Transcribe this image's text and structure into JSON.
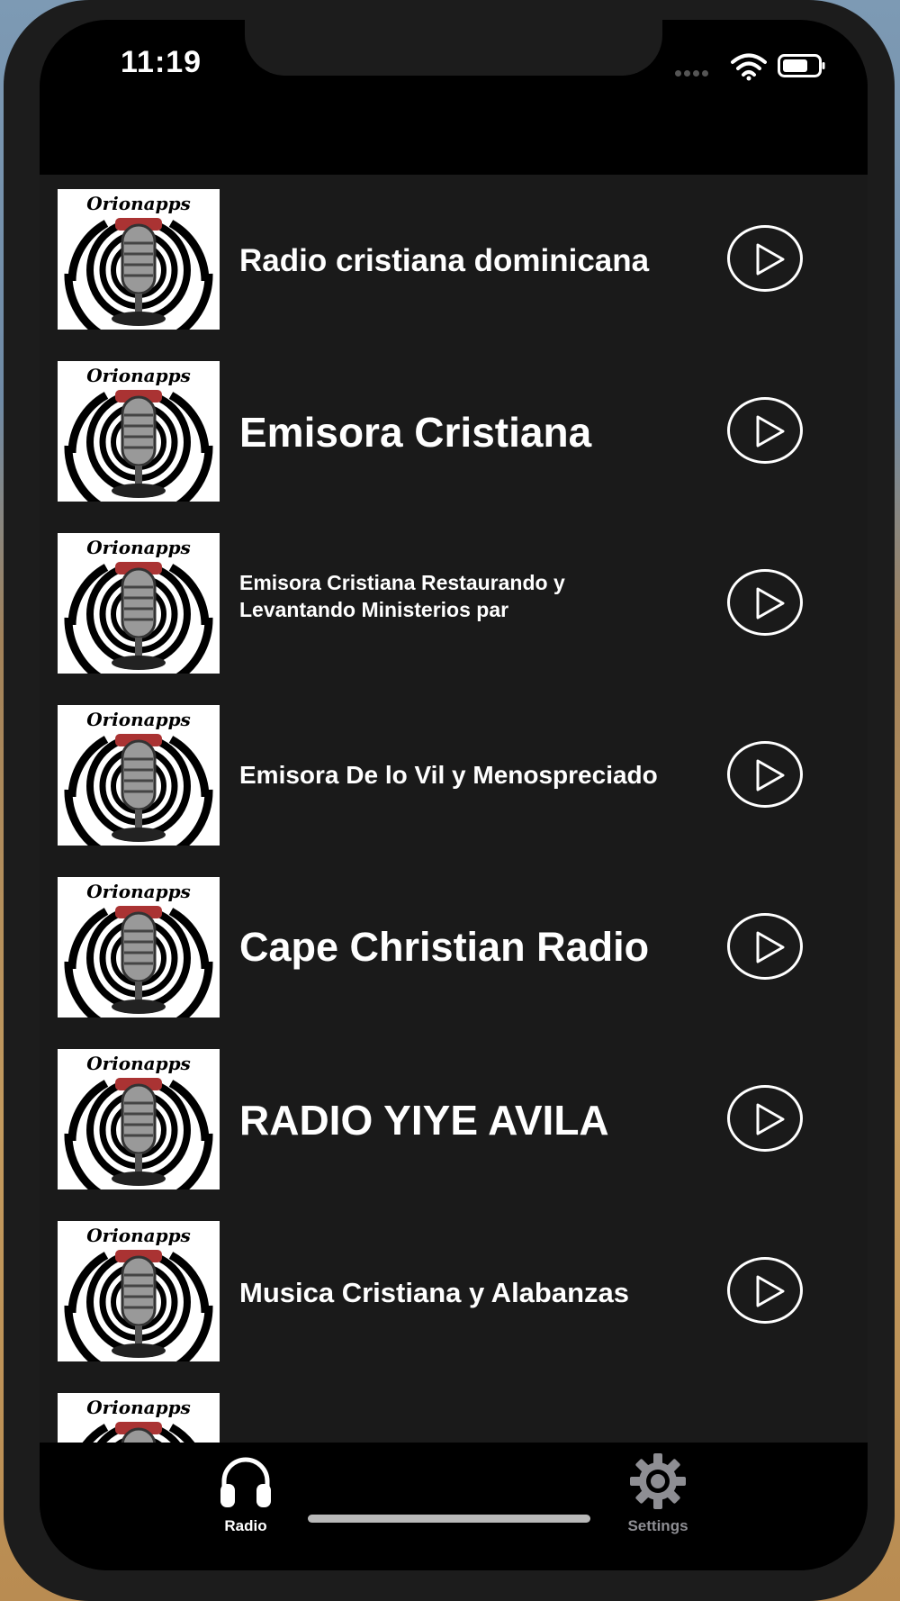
{
  "status_bar": {
    "time": "11:19"
  },
  "stations": [
    {
      "name": "Radio cristiana dominicana",
      "logo_text": "Orionapps"
    },
    {
      "name": "Emisora Cristiana",
      "logo_text": "Orionapps"
    },
    {
      "name": "Emisora Cristiana Restaurando y",
      "name_line2": "Levantando Ministerios par",
      "logo_text": "Orionapps"
    },
    {
      "name": "Emisora De lo Vil y Menospreciado",
      "logo_text": "Orionapps"
    },
    {
      "name": "Cape Christian Radio",
      "logo_text": "Orionapps"
    },
    {
      "name": "RADIO YIYE AVILA",
      "logo_text": "Orionapps"
    },
    {
      "name": "Musica Cristiana y Alabanzas",
      "logo_text": "Orionapps"
    },
    {
      "name": "",
      "logo_text": "Orionapps"
    }
  ],
  "tabs": [
    {
      "label": "Radio",
      "icon": "headphones-icon",
      "selected": true
    },
    {
      "label": "Settings",
      "icon": "gear-icon",
      "selected": false
    }
  ],
  "colors": {
    "list_background": "#1a1a1a",
    "bar_background": "#000000",
    "text": "#ffffff",
    "tab_active": "#ffffff",
    "tab_inactive": "#8e8e93"
  }
}
